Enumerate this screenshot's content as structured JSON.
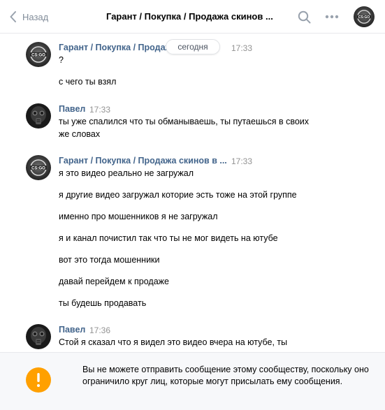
{
  "header": {
    "back_label": "Назад",
    "title": "Гарант / Покупка / Продажа скинов ..."
  },
  "date_separator": "сегодня",
  "groups": [
    {
      "author": "Гарант / Покупка / Продаж...",
      "time": "17:33",
      "avatar": "csgo-logo",
      "lines": [
        "?",
        "с чего ты взял"
      ]
    },
    {
      "author": "Павел",
      "time": "17:33",
      "avatar": "gas-mask",
      "lines": [
        "ты уже спалился что ты обманываешь, ты путаешься в своих",
        "же словах"
      ]
    },
    {
      "author": "Гарант / Покупка / Продажа скинов в ...",
      "time": "17:33",
      "avatar": "csgo-logo",
      "lines": [
        "я это видео реально не загружал",
        "я другие видео загружал которие эсть тоже на этой группе",
        "именно про мошенников я не загружал",
        "я и канал почистил так что ты не мог видеть на ютубе",
        "вот это тогда мошенники",
        "давай перейдем к продаже",
        "ты будешь продавать"
      ]
    },
    {
      "author": "Павел",
      "time": "17:36",
      "avatar": "gas-mask",
      "lines": [
        "Стой я сказал что я видел это видео вчера на ютубе, ты"
      ]
    }
  ],
  "footer": {
    "icon": "warning-icon",
    "text": "Вы не можете отправить сообщение этому сообществу, поскольку оно ограничило круг лиц, которые могут присылать ему сообщения."
  },
  "colors": {
    "link": "#42648b",
    "muted": "#818c99",
    "warning": "#ffa000"
  }
}
